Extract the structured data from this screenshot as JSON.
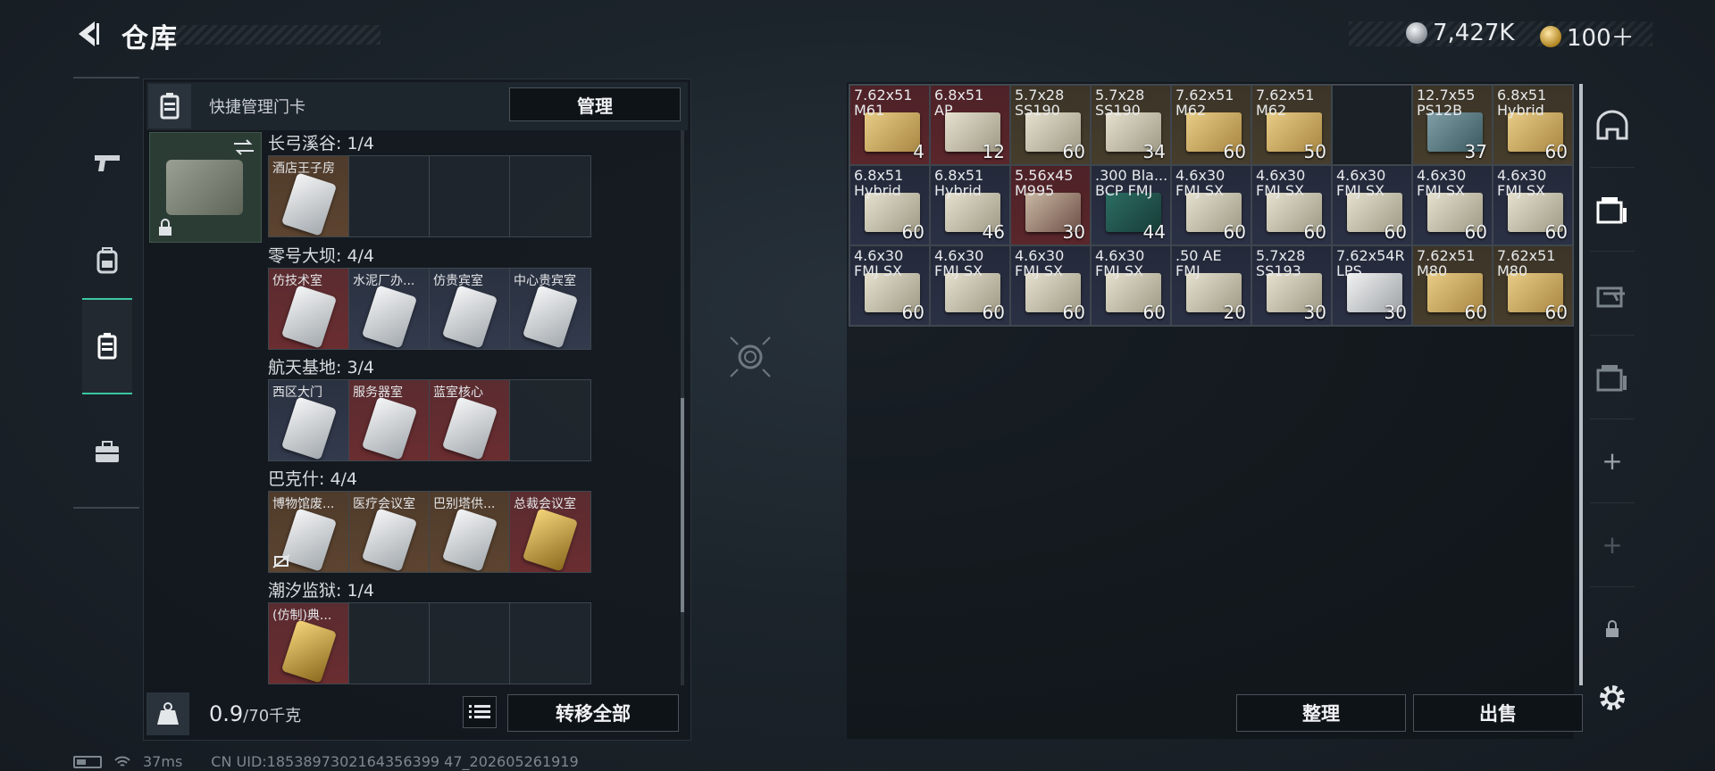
{
  "header": {
    "title": "仓库",
    "currency_silver": "7,427K",
    "currency_gold": "100＋"
  },
  "left_nav": {
    "items": [
      {
        "icon": "pistol-icon"
      },
      {
        "icon": "backpack-icon"
      },
      {
        "icon": "keycard-case-icon",
        "active": true
      },
      {
        "icon": "briefcase-icon"
      }
    ]
  },
  "keycard_panel": {
    "header_label": "快捷管理门卡",
    "manage_label": "管理",
    "groups": [
      {
        "title": "长弓溪谷: 1/4",
        "slots": [
          {
            "name": "酒店王子房",
            "color": "brown",
            "art": "silver"
          },
          {
            "name": "",
            "color": "empty"
          },
          {
            "name": "",
            "color": "empty"
          },
          {
            "name": "",
            "color": "empty"
          }
        ]
      },
      {
        "title": "零号大坝: 4/4",
        "slots": [
          {
            "name": "仿技术室",
            "color": "red",
            "art": "silver"
          },
          {
            "name": "水泥厂办...",
            "color": "blue",
            "art": "silver"
          },
          {
            "name": "仿贵宾室",
            "color": "blue",
            "art": "silver"
          },
          {
            "name": "中心贵宾室",
            "color": "blue",
            "art": "silver"
          }
        ]
      },
      {
        "title": "航天基地: 3/4",
        "slots": [
          {
            "name": "西区大门",
            "color": "blue",
            "art": "silver"
          },
          {
            "name": "服务器室",
            "color": "red",
            "art": "silver"
          },
          {
            "name": "蓝室核心",
            "color": "red",
            "art": "silver"
          },
          {
            "name": "",
            "color": "empty"
          }
        ]
      },
      {
        "title": "巴克什: 4/4",
        "slots": [
          {
            "name": "博物馆废...",
            "color": "brown",
            "art": "silver",
            "badge": true
          },
          {
            "name": "医疗会议室",
            "color": "brown",
            "art": "silver"
          },
          {
            "name": "巴别塔供...",
            "color": "brown",
            "art": "silver"
          },
          {
            "name": "总裁会议室",
            "color": "red",
            "art": "gold"
          }
        ]
      },
      {
        "title": "潮汐监狱: 1/4",
        "slots": [
          {
            "name": "(仿制)典...",
            "color": "red",
            "art": "gold"
          },
          {
            "name": "",
            "color": "empty"
          },
          {
            "name": "",
            "color": "empty"
          },
          {
            "name": "",
            "color": "empty"
          }
        ]
      }
    ],
    "weight_current": "0.9",
    "weight_max": "/70千克",
    "transfer_all_label": "转移全部"
  },
  "storage": {
    "items": [
      {
        "name": "7.62x51\nM61",
        "qty": "4",
        "bg": "red",
        "box": "tan"
      },
      {
        "name": "6.8x51\nAP",
        "qty": "12",
        "bg": "red",
        "box": "cream"
      },
      {
        "name": "5.7x28\nSS190",
        "qty": "60",
        "bg": "olive",
        "box": "cream"
      },
      {
        "name": "5.7x28\nSS190",
        "qty": "34",
        "bg": "olive",
        "box": "cream"
      },
      {
        "name": "7.62x51\nM62",
        "qty": "60",
        "bg": "olive",
        "box": "tan"
      },
      {
        "name": "7.62x51\nM62",
        "qty": "50",
        "bg": "olive",
        "box": "tan"
      },
      {
        "name": "",
        "qty": "",
        "bg": "dark",
        "box": ""
      },
      {
        "name": "12.7x55\nPS12B",
        "qty": "37",
        "bg": "olive",
        "box": "teal"
      },
      {
        "name": "6.8x51\nHybrid",
        "qty": "60",
        "bg": "olive",
        "box": "tan"
      },
      {
        "name": "6.8x51\nHybrid",
        "qty": "60",
        "bg": "navy",
        "box": "cream"
      },
      {
        "name": "6.8x51\nHybrid",
        "qty": "46",
        "bg": "navy",
        "box": "cream"
      },
      {
        "name": "5.56x45\nM995",
        "qty": "30",
        "bg": "red",
        "box": "redbox"
      },
      {
        "name": ".300 Bla...\nBCP FMJ",
        "qty": "44",
        "bg": "navy",
        "box": "green"
      },
      {
        "name": "4.6x30\nFMJ SX",
        "qty": "60",
        "bg": "navy",
        "box": "cream"
      },
      {
        "name": "4.6x30\nFMJ SX",
        "qty": "60",
        "bg": "navy",
        "box": "cream"
      },
      {
        "name": "4.6x30\nFMJ SX",
        "qty": "60",
        "bg": "navy",
        "box": "cream"
      },
      {
        "name": "4.6x30\nFMJ SX",
        "qty": "60",
        "bg": "navy",
        "box": "cream"
      },
      {
        "name": "4.6x30\nFMJ SX",
        "qty": "60",
        "bg": "navy",
        "box": "cream"
      },
      {
        "name": "4.6x30\nFMJ SX",
        "qty": "60",
        "bg": "navy",
        "box": "cream"
      },
      {
        "name": "4.6x30\nFMJ SX",
        "qty": "60",
        "bg": "navy",
        "box": "cream"
      },
      {
        "name": "4.6x30\nFMJ SX",
        "qty": "60",
        "bg": "navy",
        "box": "cream"
      },
      {
        "name": "4.6x30\nFMJ SX",
        "qty": "60",
        "bg": "navy",
        "box": "cream"
      },
      {
        "name": ".50 AE\nFMJ",
        "qty": "20",
        "bg": "navy",
        "box": "cream"
      },
      {
        "name": "5.7x28\nSS193",
        "qty": "30",
        "bg": "navy",
        "box": "cream"
      },
      {
        "name": "7.62x54R\nLPS",
        "qty": "30",
        "bg": "navy",
        "box": "white"
      },
      {
        "name": "7.62x51\nM80",
        "qty": "60",
        "bg": "olive",
        "box": "tan"
      },
      {
        "name": "7.62x51\nM80",
        "qty": "60",
        "bg": "olive",
        "box": "tan"
      }
    ],
    "sort_label": "整理",
    "sell_label": "出售"
  },
  "status_bar": {
    "ping": "37ms",
    "uid": "CN UID:1853897302164356399 47_202605261919"
  }
}
